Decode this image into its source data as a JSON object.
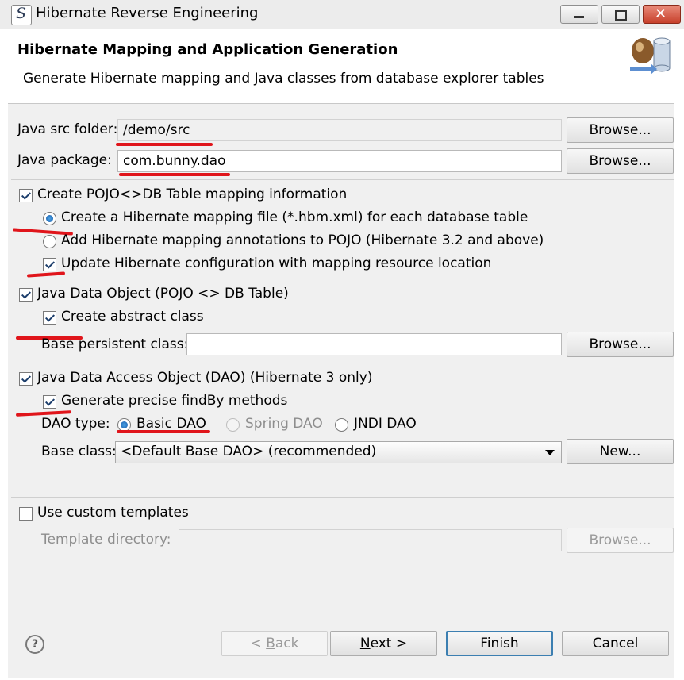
{
  "window": {
    "title": "Hibernate Reverse Engineering",
    "app_icon_glyph": "S"
  },
  "header": {
    "title": "Hibernate Mapping and Application Generation",
    "description": "Generate Hibernate mapping and Java classes from database explorer tables"
  },
  "src_folder": {
    "label": "Java src folder:",
    "value": "/demo/src",
    "browse": "Browse..."
  },
  "package": {
    "label": "Java package:",
    "value": "com.bunny.dao",
    "browse": "Browse..."
  },
  "mapping": {
    "checkbox_label": "Create POJO<>DB Table mapping information",
    "checked": true,
    "option_hbm": "Create a Hibernate mapping file (*.hbm.xml) for each database table",
    "option_annotations": "Add Hibernate mapping annotations to POJO (Hibernate 3.2 and above)",
    "selected_option": "hbm",
    "update_config_label": "Update Hibernate configuration with mapping resource location",
    "update_config_checked": true
  },
  "pojo": {
    "checkbox_label": "Java Data Object (POJO <> DB Table)",
    "checked": true,
    "abstract_label": "Create abstract class",
    "abstract_checked": true,
    "base_label": "Base persistent class:",
    "base_value": "",
    "browse": "Browse..."
  },
  "dao": {
    "checkbox_label": "Java Data Access Object (DAO) (Hibernate 3 only)",
    "checked": true,
    "findby_label": "Generate precise findBy methods",
    "findby_checked": true,
    "type_label": "DAO type:",
    "types": [
      "Basic DAO",
      "Spring DAO",
      "JNDI DAO"
    ],
    "selected_type": "Basic DAO",
    "base_class_label": "Base class:",
    "base_class_value": "<Default Base DAO> (recommended)",
    "new_button": "New..."
  },
  "templates": {
    "checkbox_label": "Use custom templates",
    "checked": false,
    "dir_label": "Template directory:",
    "dir_value": "",
    "browse": "Browse..."
  },
  "footer": {
    "help": "?",
    "back_prefix": "< ",
    "back_key": "B",
    "back_rest": "ack",
    "next_key": "N",
    "next_rest": "ext >",
    "finish": "Finish",
    "cancel": "Cancel"
  },
  "annotation_color": "#e0151b"
}
